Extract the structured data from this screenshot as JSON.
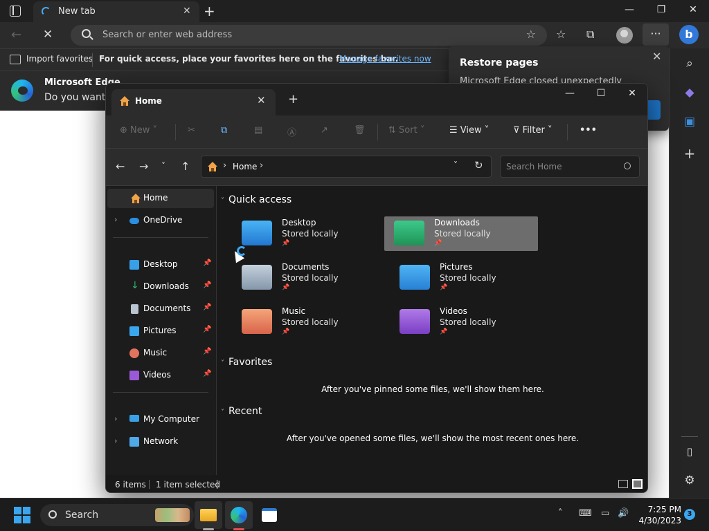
{
  "browser": {
    "tab": {
      "title": "New tab"
    },
    "address": {
      "placeholder": "Search or enter web address"
    },
    "favorites_bar": {
      "import_label": "Import favorites",
      "hint": "For quick access, place your favorites here on the favorites bar.",
      "manage_link": "Manage favorites now"
    },
    "infobar": {
      "title": "Microsoft Edge",
      "message": "Do you want t"
    },
    "restore_popup": {
      "title": "Restore pages",
      "message": "Microsoft Edge closed unexpectedly"
    }
  },
  "explorer": {
    "tab": {
      "label": "Home"
    },
    "commands": {
      "new_label": "New",
      "sort_label": "Sort",
      "view_label": "View",
      "filter_label": "Filter",
      "more_label": "•••"
    },
    "address": {
      "path": "Home",
      "search_placeholder": "Search Home"
    },
    "nav": {
      "home": "Home",
      "onedrive": "OneDrive",
      "pinned": [
        {
          "label": "Desktop",
          "icon": "desktop-folder-icon",
          "color": "#38a0e8"
        },
        {
          "label": "Downloads",
          "icon": "download-arrow-icon",
          "color": "#2fb36b"
        },
        {
          "label": "Documents",
          "icon": "document-icon",
          "color": "#b8c4d0"
        },
        {
          "label": "Pictures",
          "icon": "pictures-icon",
          "color": "#3aa6ee"
        },
        {
          "label": "Music",
          "icon": "music-icon",
          "color": "#e2735c"
        },
        {
          "label": "Videos",
          "icon": "videos-icon",
          "color": "#9a5ad8"
        }
      ],
      "my_computer": "My Computer",
      "network": "Network"
    },
    "sections": {
      "quick_access": "Quick access",
      "favorites": "Favorites",
      "recent": "Recent"
    },
    "quick_access": [
      {
        "name": "Desktop",
        "status": "Stored locally",
        "icon": "desktop-folder-icon",
        "color": "#2f8fe0",
        "selected": false
      },
      {
        "name": "Downloads",
        "status": "Stored locally",
        "icon": "downloads-folder-icon",
        "color": "#27a86a",
        "selected": true
      },
      {
        "name": "Documents",
        "status": "Stored locally",
        "icon": "documents-folder-icon",
        "color": "#9fb1c4",
        "selected": false
      },
      {
        "name": "Pictures",
        "status": "Stored locally",
        "icon": "pictures-folder-icon",
        "color": "#3a9fe8",
        "selected": false
      },
      {
        "name": "Music",
        "status": "Stored locally",
        "icon": "music-folder-icon",
        "color": "#e58a62",
        "selected": false
      },
      {
        "name": "Videos",
        "status": "Stored locally",
        "icon": "videos-folder-icon",
        "color": "#9357d4",
        "selected": false
      }
    ],
    "favorites_empty": "After you've pinned some files, we'll show them here.",
    "recent_empty": "After you've opened some files, we'll show the most recent ones here.",
    "status": {
      "items": "6 items",
      "selected": "1 item selected"
    }
  },
  "taskbar": {
    "search_label": "Search",
    "time": "7:25 PM",
    "date": "4/30/2023",
    "notification_count": "3"
  }
}
